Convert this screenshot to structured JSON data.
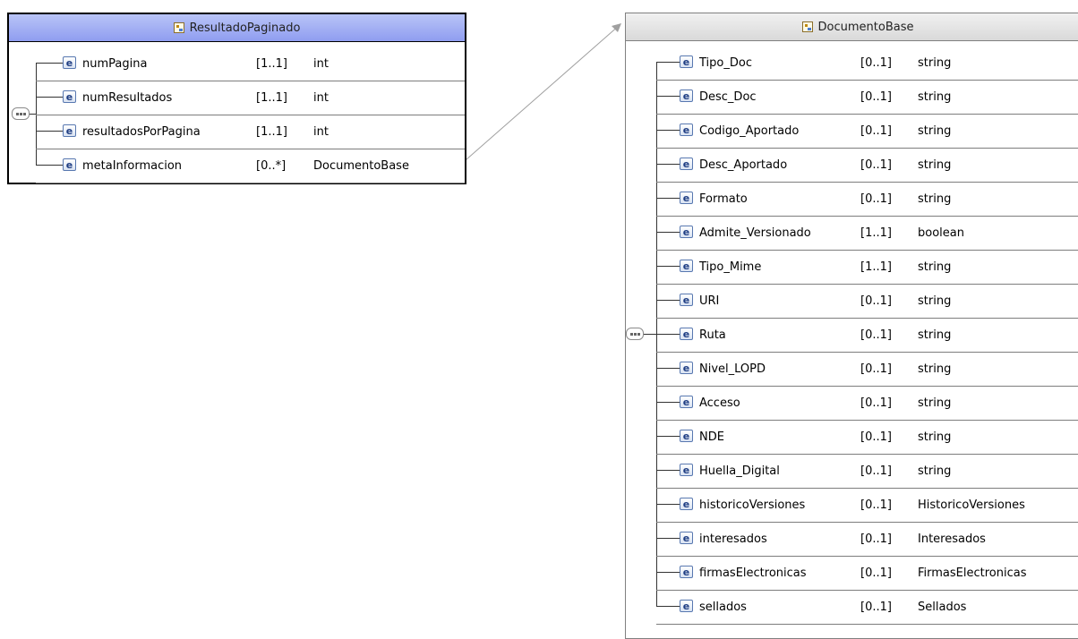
{
  "box_a": {
    "title": "ResultadoPaginado",
    "elements": [
      {
        "badge": "e",
        "name": "numPagina",
        "mult": "[1..1]",
        "type": "int"
      },
      {
        "badge": "e",
        "name": "numResultados",
        "mult": "[1..1]",
        "type": "int"
      },
      {
        "badge": "e",
        "name": "resultadosPorPagina",
        "mult": "[1..1]",
        "type": "int"
      },
      {
        "badge": "e",
        "name": "metaInformacion",
        "mult": "[0..*]",
        "type": "DocumentoBase"
      }
    ]
  },
  "box_b": {
    "title": "DocumentoBase",
    "elements": [
      {
        "badge": "e",
        "name": "Tipo_Doc",
        "mult": "[0..1]",
        "type": "string"
      },
      {
        "badge": "e",
        "name": "Desc_Doc",
        "mult": "[0..1]",
        "type": "string"
      },
      {
        "badge": "e",
        "name": "Codigo_Aportado",
        "mult": "[0..1]",
        "type": "string"
      },
      {
        "badge": "e",
        "name": "Desc_Aportado",
        "mult": "[0..1]",
        "type": "string"
      },
      {
        "badge": "e",
        "name": "Formato",
        "mult": "[0..1]",
        "type": "string"
      },
      {
        "badge": "e",
        "name": "Admite_Versionado",
        "mult": "[1..1]",
        "type": "boolean"
      },
      {
        "badge": "e",
        "name": "Tipo_Mime",
        "mult": "[1..1]",
        "type": "string"
      },
      {
        "badge": "e",
        "name": "URI",
        "mult": "[0..1]",
        "type": "string"
      },
      {
        "badge": "e",
        "name": "Ruta",
        "mult": "[0..1]",
        "type": "string"
      },
      {
        "badge": "e",
        "name": "Nivel_LOPD",
        "mult": "[0..1]",
        "type": "string"
      },
      {
        "badge": "e",
        "name": "Acceso",
        "mult": "[0..1]",
        "type": "string"
      },
      {
        "badge": "e",
        "name": "NDE",
        "mult": "[0..1]",
        "type": "string"
      },
      {
        "badge": "e",
        "name": "Huella_Digital",
        "mult": "[0..1]",
        "type": "string"
      },
      {
        "badge": "e",
        "name": "historicoVersiones",
        "mult": "[0..1]",
        "type": "HistoricoVersiones"
      },
      {
        "badge": "e",
        "name": "interesados",
        "mult": "[0..1]",
        "type": "Interesados"
      },
      {
        "badge": "e",
        "name": "firmasElectronicas",
        "mult": "[0..1]",
        "type": "FirmasElectronicas"
      },
      {
        "badge": "e",
        "name": "sellados",
        "mult": "[0..1]",
        "type": "Sellados"
      }
    ]
  },
  "colors": {
    "header_a": "#a3aff4",
    "header_b": "#e5e5e5",
    "badge_text": "#1e3d83"
  }
}
